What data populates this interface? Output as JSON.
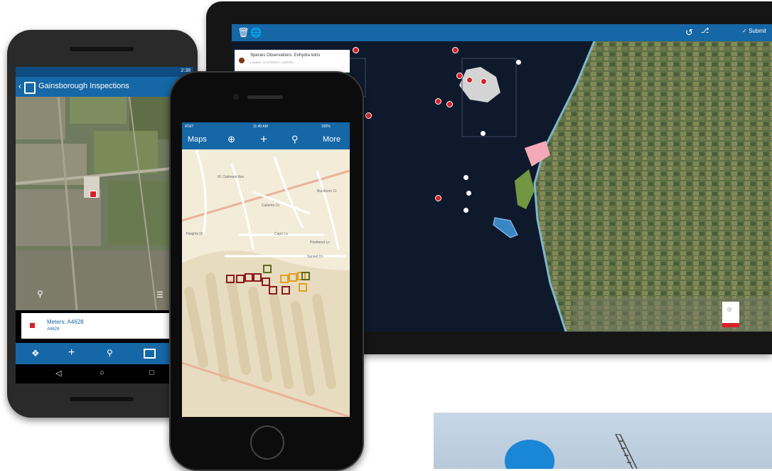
{
  "tablet": {
    "toolbar_icons": [
      "trash-icon",
      "globe-icon",
      "undo-icon",
      "pin-icon"
    ],
    "submit_label": "Submit",
    "popup": {
      "title": "Species Observations: Enhydra lutris",
      "subtitle": "Location: 32.578000N 1.128000W"
    }
  },
  "android": {
    "status_time": "2:38",
    "app_title": "Gainsborough Inspections",
    "card": {
      "title": "Meters: A4628",
      "subtitle": "A4628"
    },
    "bottom_icons": [
      "locate-icon",
      "add-icon",
      "search-icon",
      "layers-icon"
    ],
    "nav_icons": [
      "back-icon",
      "home-icon",
      "recents-icon"
    ]
  },
  "iphone": {
    "status": {
      "carrier": "AT&T",
      "time": "11:40 AM",
      "battery": "100%"
    },
    "nav": {
      "maps_label": "Maps",
      "more_label": "More"
    },
    "street_labels": [
      "W. Oakmont Ave",
      "Caliente Ct",
      "Capri Ln",
      "Buckhorn Ct",
      "Piedmont Ln",
      "Heights Dr",
      "Sunset Dr"
    ]
  },
  "colors": {
    "brand_blue": "#1567a6",
    "alert_red": "#d8202a"
  }
}
